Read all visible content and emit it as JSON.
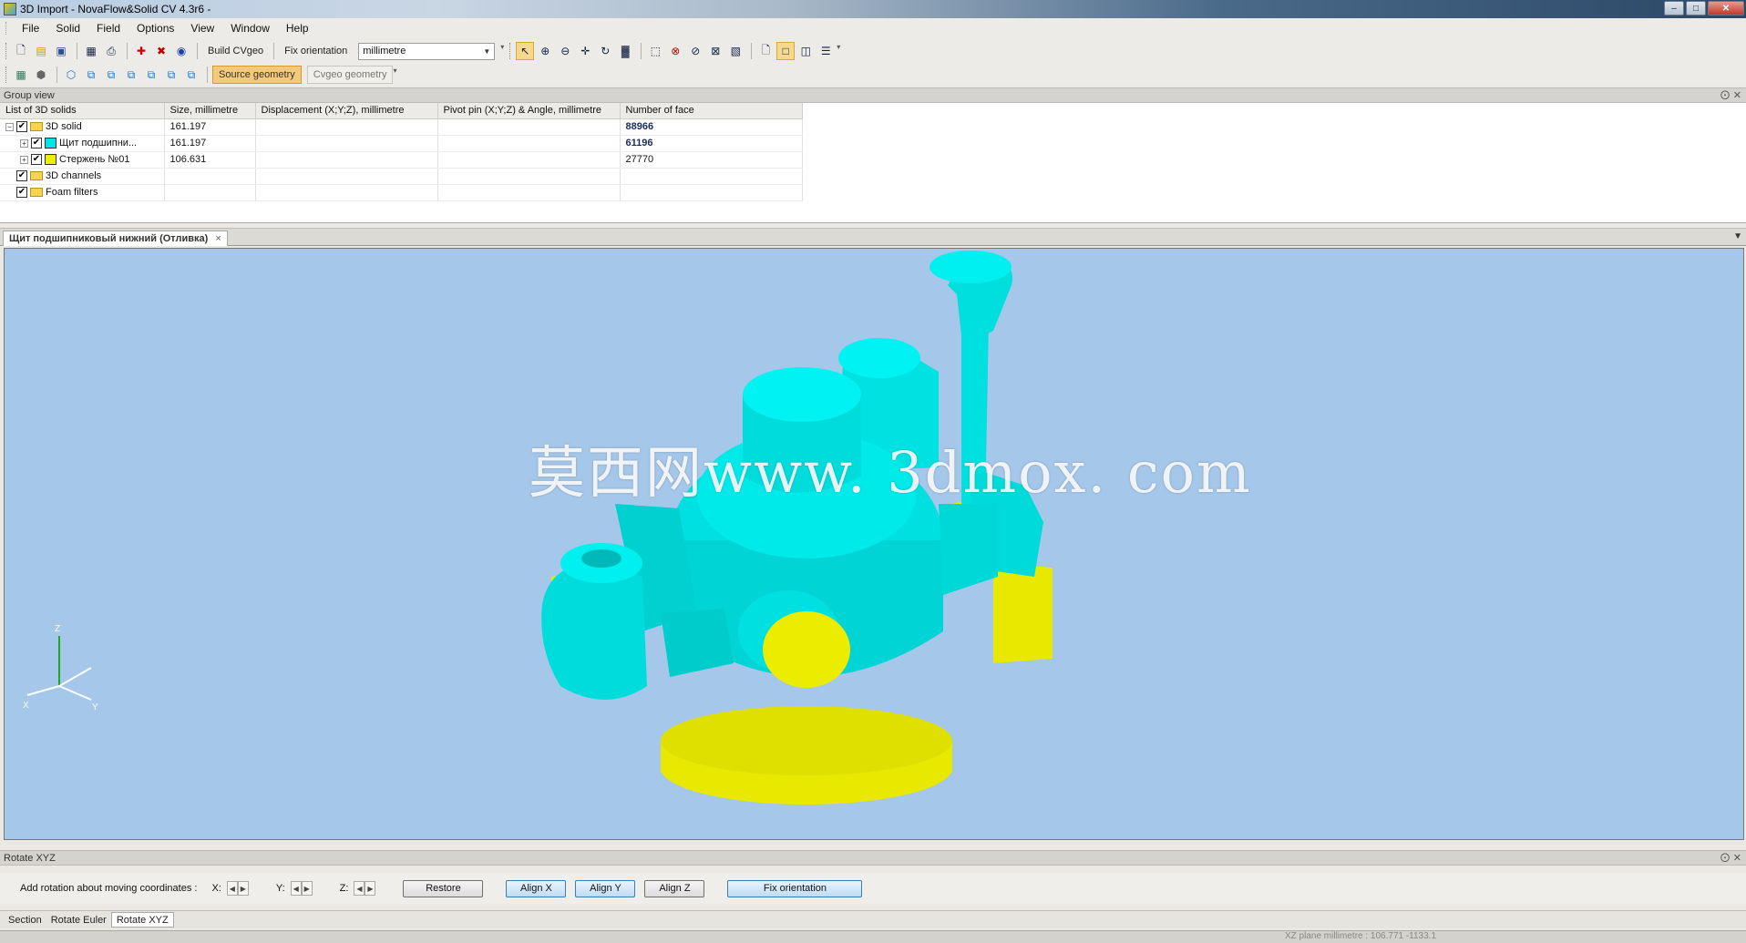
{
  "window": {
    "title": "3D Import - NovaFlow&Solid CV 4.3r6 -",
    "minimize": "–",
    "maximize": "□",
    "close": "✕"
  },
  "menu": [
    "File",
    "Solid",
    "Field",
    "Options",
    "View",
    "Window",
    "Help"
  ],
  "toolbar": {
    "build_cvgeo": "Build CVgeo",
    "fix_orientation": "Fix orientation",
    "units": "millimetre",
    "source_geometry": "Source geometry",
    "cvgeo_geometry": "Cvgeo geometry"
  },
  "group_view": {
    "header": "Group view",
    "columns": [
      "List of 3D solids",
      "Size, millimetre",
      "Displacement (X;Y;Z), millimetre",
      "Pivot pin (X;Y;Z) & Angle, millimetre",
      "Number of face"
    ],
    "rows": [
      {
        "name": "3D solid",
        "size": "161.197",
        "displacement": "",
        "pivot": "",
        "faces": "88966",
        "icon": "folder-icon",
        "expander": "−"
      },
      {
        "name": "Щит подшипни...",
        "size": "161.197",
        "displacement": "",
        "pivot": "",
        "faces": "61196",
        "icon": "cyan-swatch",
        "expander": "+"
      },
      {
        "name": "Стержень №01",
        "size": "106.631",
        "displacement": "",
        "pivot": "",
        "faces": "27770",
        "icon": "yellow-swatch",
        "expander": "+"
      },
      {
        "name": "3D channels",
        "size": "",
        "displacement": "",
        "pivot": "",
        "faces": "",
        "icon": "folder-icon",
        "expander": ""
      },
      {
        "name": "Foam filters",
        "size": "",
        "displacement": "",
        "pivot": "",
        "faces": "",
        "icon": "folder-icon",
        "expander": ""
      }
    ]
  },
  "document_tab": {
    "title": "Щит подшипниковый нижний (Отливка)",
    "close": "×"
  },
  "viewport": {
    "background": "#a4c7ea",
    "casting_color": "#00e6e6",
    "core_color": "#eeee00",
    "watermark": "莫西网www. 3dmox. com",
    "axes": {
      "z": "Z",
      "x": "X",
      "y": "Y"
    }
  },
  "rotate_panel": {
    "header": "Rotate XYZ",
    "label": "Add rotation about moving coordinates :",
    "x": "X:",
    "y": "Y:",
    "z": "Z:",
    "restore": "Restore",
    "align_x": "Align X",
    "align_y": "Align Y",
    "align_z": "Align Z",
    "fix_orientation": "Fix orientation"
  },
  "bottom_tabs": [
    "Section",
    "Rotate Euler",
    "Rotate XYZ"
  ],
  "status": "XZ plane millimetre : 106.771 -1133.1"
}
